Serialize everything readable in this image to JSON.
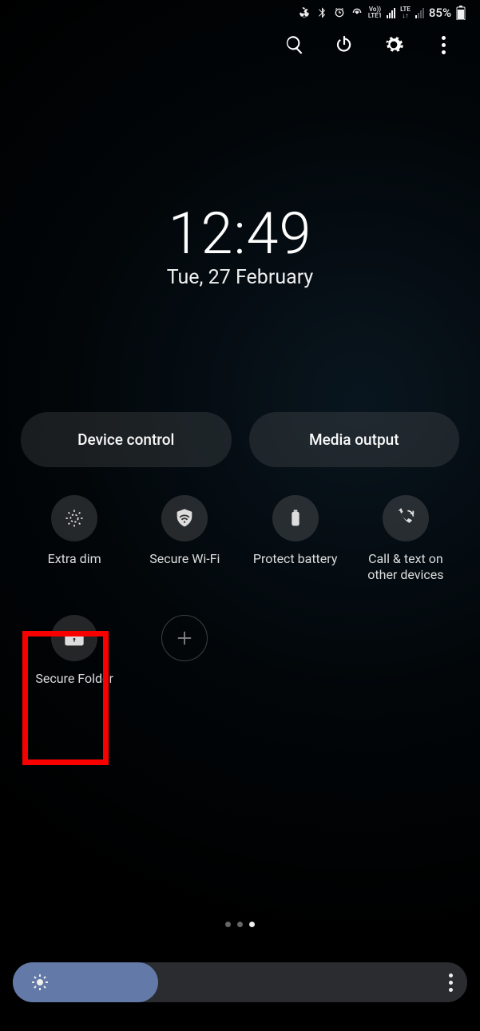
{
  "status": {
    "volte": "Vo))",
    "lte_line": "LTE1",
    "net": "LTE",
    "battery_pct": "85%"
  },
  "clock": {
    "time": "12:49",
    "date": "Tue, 27 February"
  },
  "pills": {
    "device_control": "Device control",
    "media_output": "Media output"
  },
  "tiles": {
    "extra_dim": "Extra dim",
    "secure_wifi": "Secure Wi-Fi",
    "protect_battery": "Protect battery",
    "call_text": "Call & text on other devices",
    "secure_folder": "Secure Folder"
  },
  "highlight": {
    "target": "secure-folder-tile"
  }
}
